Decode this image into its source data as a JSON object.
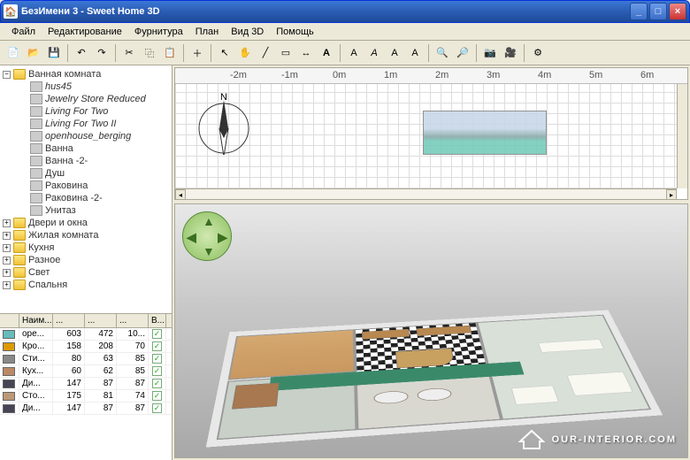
{
  "window": {
    "title": "БезИмени 3 - Sweet Home 3D"
  },
  "menu": {
    "items": [
      "Файл",
      "Редактирование",
      "Фурнитура",
      "План",
      "Вид 3D",
      "Помощь"
    ]
  },
  "toolbar": {
    "icons": [
      "new-file-icon",
      "open-file-icon",
      "save-icon",
      "undo-icon",
      "redo-icon",
      "cut-icon",
      "copy-icon",
      "paste-icon",
      "add-furniture-icon",
      "select-icon",
      "pan-icon",
      "wall-icon",
      "room-icon",
      "dimension-icon",
      "text-icon",
      "text-bold-icon",
      "text-italic-icon",
      "ruler-icon",
      "grid-icon",
      "zoom-in-icon",
      "zoom-out-icon",
      "camera-icon",
      "video-icon",
      "preferences-icon"
    ]
  },
  "tree": {
    "root": {
      "label": "Ванная комната",
      "expanded": true
    },
    "children": [
      {
        "label": "hus45",
        "italic": true
      },
      {
        "label": "Jewelry Store Reduced",
        "italic": true
      },
      {
        "label": "Living For Two",
        "italic": true
      },
      {
        "label": "Living For Two II",
        "italic": true
      },
      {
        "label": "openhouse_berging",
        "italic": true
      },
      {
        "label": "Ванна",
        "italic": false
      },
      {
        "label": "Ванна -2-",
        "italic": false
      },
      {
        "label": "Душ",
        "italic": false
      },
      {
        "label": "Раковина",
        "italic": false
      },
      {
        "label": "Раковина -2-",
        "italic": false
      },
      {
        "label": "Унитаз",
        "italic": false
      }
    ],
    "siblings": [
      {
        "label": "Двери и окна"
      },
      {
        "label": "Жилая комната"
      },
      {
        "label": "Кухня"
      },
      {
        "label": "Разное"
      },
      {
        "label": "Свет"
      },
      {
        "label": "Спальня"
      }
    ]
  },
  "furniture_table": {
    "columns": [
      "Наим...",
      "...",
      "...",
      "...",
      "В..."
    ],
    "rows": [
      {
        "name": "оре...",
        "c1": "603",
        "c2": "472",
        "c3": "10...",
        "vis": true,
        "color": "#6bb"
      },
      {
        "name": "Кро...",
        "c1": "158",
        "c2": "208",
        "c3": "70",
        "vis": true,
        "color": "#d90"
      },
      {
        "name": "Сти...",
        "c1": "80",
        "c2": "63",
        "c3": "85",
        "vis": true,
        "color": "#888"
      },
      {
        "name": "Кух...",
        "c1": "60",
        "c2": "62",
        "c3": "85",
        "vis": true,
        "color": "#b86"
      },
      {
        "name": "Ди...",
        "c1": "147",
        "c2": "87",
        "c3": "87",
        "vis": true,
        "color": "#445"
      },
      {
        "name": "Сто...",
        "c1": "175",
        "c2": "81",
        "c3": "74",
        "vis": true,
        "color": "#b97"
      },
      {
        "name": "Ди...",
        "c1": "147",
        "c2": "87",
        "c3": "87",
        "vis": true,
        "color": "#445"
      }
    ]
  },
  "plan": {
    "ruler_marks": [
      "-2m",
      "-1m",
      "0m",
      "1m",
      "2m",
      "3m",
      "4m",
      "5m",
      "6m"
    ],
    "compass_label": "N"
  },
  "watermark": {
    "text": "OUR-INTERIOR.COM"
  }
}
